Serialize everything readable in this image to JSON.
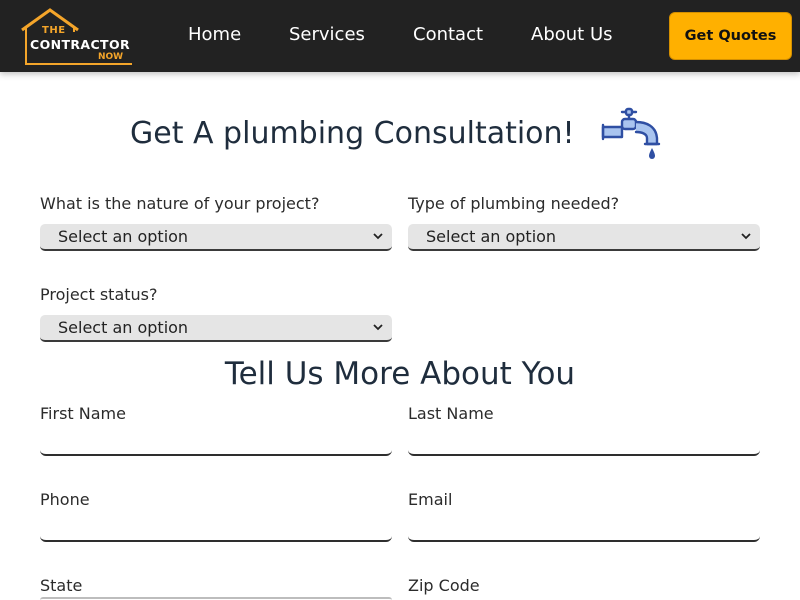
{
  "brand": {
    "line1": "THE",
    "line2": "CONTRACTOR",
    "line3": "NOW"
  },
  "nav": {
    "home": "Home",
    "services": "Services",
    "contact": "Contact",
    "about": "About Us",
    "cta": "Get Quotes"
  },
  "consultation": {
    "title": "Get A plumbing Consultation!",
    "icon": "faucet-icon",
    "fields": {
      "nature_label": "What is the nature of your project?",
      "nature_value": "Select an option",
      "type_label": "Type of plumbing needed?",
      "type_value": "Select an option",
      "status_label": "Project status?",
      "status_value": "Select an option"
    }
  },
  "about_you": {
    "title": "Tell Us More About You",
    "first_name_label": "First Name",
    "last_name_label": "Last Name",
    "phone_label": "Phone",
    "email_label": "Email",
    "state_label": "State",
    "zip_label": "Zip Code"
  },
  "colors": {
    "header_bg": "#222222",
    "accent": "#ffb000",
    "logo_orange": "#f4a52a",
    "icon_blue": "#2f4fa3"
  }
}
